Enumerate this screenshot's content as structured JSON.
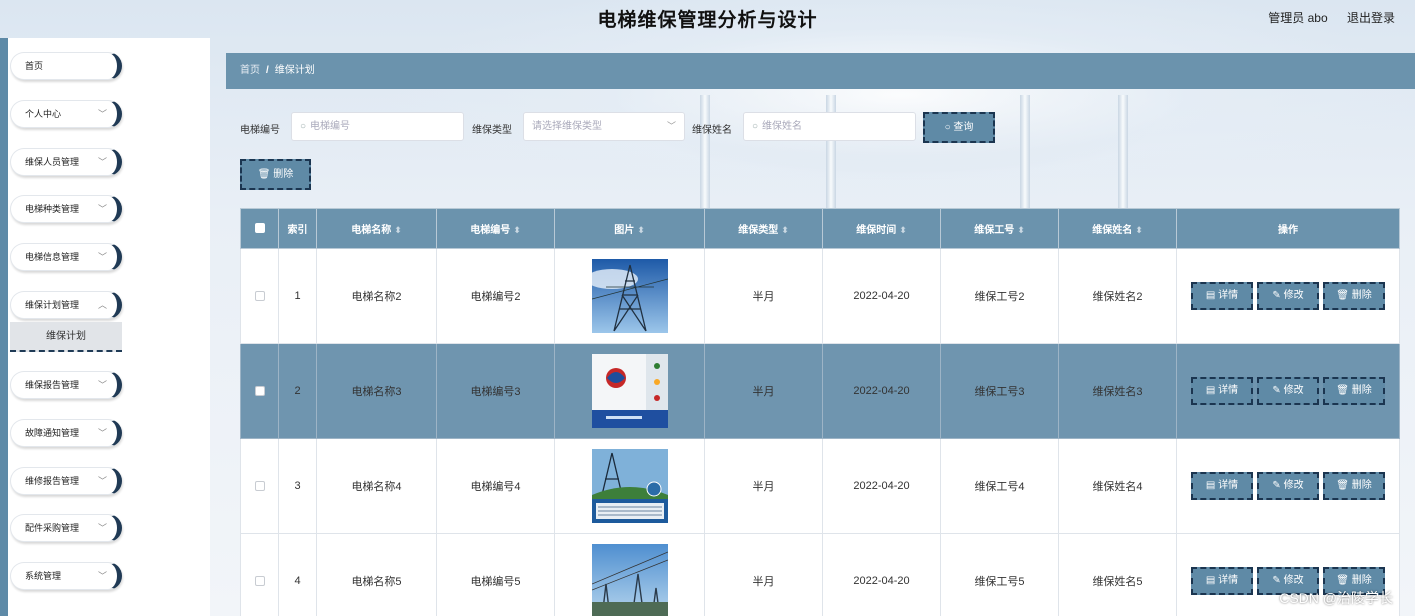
{
  "header": {
    "title": "电梯维保管理分析与设计",
    "user": "管理员 abo",
    "logout": "退出登录"
  },
  "sidebar": {
    "items": [
      {
        "label": "首页",
        "has_arrow": false
      },
      {
        "label": "个人中心",
        "has_arrow": true
      },
      {
        "label": "维保人员管理",
        "has_arrow": true
      },
      {
        "label": "电梯种类管理",
        "has_arrow": true
      },
      {
        "label": "电梯信息管理",
        "has_arrow": true
      },
      {
        "label": "维保计划管理",
        "has_arrow": true
      },
      {
        "label": "维保报告管理",
        "has_arrow": true
      },
      {
        "label": "故障通知管理",
        "has_arrow": true
      },
      {
        "label": "维修报告管理",
        "has_arrow": true
      },
      {
        "label": "配件采购管理",
        "has_arrow": true
      },
      {
        "label": "系统管理",
        "has_arrow": true
      }
    ],
    "submenu_active": "维保计划"
  },
  "breadcrumb": {
    "home": "首页",
    "separator": "/",
    "current": "维保计划"
  },
  "filters": {
    "code_label": "电梯编号",
    "code_placeholder": "电梯编号",
    "type_label": "维保类型",
    "type_placeholder": "请选择维保类型",
    "name_label": "维保姓名",
    "name_placeholder": "维保姓名",
    "search_button": "查询",
    "delete_button": "删除"
  },
  "table": {
    "columns": [
      "索引",
      "电梯名称",
      "电梯编号",
      "图片",
      "维保类型",
      "维保时间",
      "维保工号",
      "维保姓名",
      "操作"
    ],
    "sortable": [
      false,
      true,
      true,
      true,
      true,
      true,
      true,
      true,
      false
    ],
    "rows": [
      {
        "index": "1",
        "name": "电梯名称2",
        "code": "电梯编号2",
        "image": "power-tower",
        "type": "半月",
        "time": "2022-04-20",
        "worker_id": "维保工号2",
        "worker_name": "维保姓名2",
        "selected": false
      },
      {
        "index": "2",
        "name": "电梯名称3",
        "code": "电梯编号3",
        "image": "brochure",
        "type": "半月",
        "time": "2022-04-20",
        "worker_id": "维保工号3",
        "worker_name": "维保姓名3",
        "selected": true
      },
      {
        "index": "3",
        "name": "电梯名称4",
        "code": "电梯编号4",
        "image": "substation-poster",
        "type": "半月",
        "time": "2022-04-20",
        "worker_id": "维保工号4",
        "worker_name": "维保姓名4",
        "selected": false
      },
      {
        "index": "4",
        "name": "电梯名称5",
        "code": "电梯编号5",
        "image": "substation",
        "type": "半月",
        "time": "2022-04-20",
        "worker_id": "维保工号5",
        "worker_name": "维保姓名5",
        "selected": false
      }
    ],
    "actions": {
      "detail": "详情",
      "edit": "修改",
      "delete": "删除"
    }
  },
  "watermark": "CSDN @治陵学长",
  "colors": {
    "accent": "#6b93ad",
    "dark_border": "#1b3550"
  }
}
